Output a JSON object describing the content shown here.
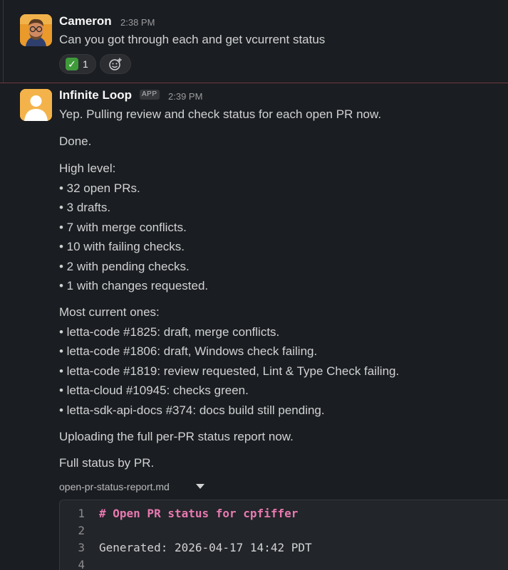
{
  "messages": [
    {
      "author": "Cameron",
      "time": "2:38 PM",
      "text": "Can you got through each and get vcurrent status",
      "reactions": [
        {
          "emoji": "✓",
          "count": "1"
        }
      ]
    },
    {
      "author": "Infinite Loop",
      "badge": "APP",
      "time": "2:39 PM",
      "lines": [
        "Yep. Pulling review and check status for each open PR now.",
        "Done.",
        "High level:",
        "• 32 open PRs.",
        "• 3 drafts.",
        "• 7 with merge conflicts.",
        "• 10 with failing checks.",
        "• 2 with pending checks.",
        "• 1 with changes requested.",
        "Most current ones:",
        "• letta-code #1825: draft, merge conflicts.",
        "• letta-code #1806: draft, Windows check failing.",
        "• letta-code #1819: review requested, Lint & Type Check failing.",
        "• letta-cloud #10945: checks green.",
        "• letta-sdk-api-docs #374: docs build still pending.",
        "Uploading the full per-PR status report now.",
        "Full status by PR."
      ],
      "file": {
        "name": "open-pr-status-report.md",
        "code_lines": [
          {
            "n": "1",
            "text": "# Open PR status for cpfiffer"
          },
          {
            "n": "2",
            "text": ""
          },
          {
            "n": "3",
            "text": "Generated: 2026-04-17 14:42 PDT"
          },
          {
            "n": "4",
            "text": ""
          }
        ]
      }
    }
  ],
  "colors": {
    "background": "#1a1d21",
    "divider": "#6e3a3e",
    "code_heading": "#e879b0",
    "bot_avatar": "#f4b34a"
  }
}
